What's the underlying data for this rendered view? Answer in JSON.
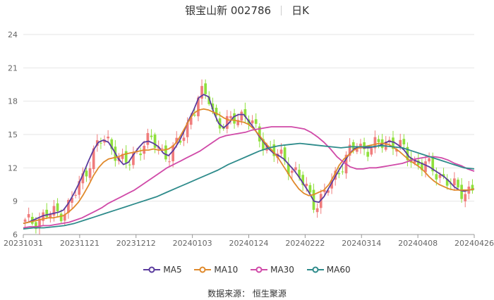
{
  "header": {
    "stock_title": "银宝山新 002786",
    "period": "日K"
  },
  "source": "数据来源：  恒生聚源",
  "legend": [
    {
      "name": "MA5",
      "color": "#5b3c9e"
    },
    {
      "name": "MA10",
      "color": "#e08a2c"
    },
    {
      "name": "MA30",
      "color": "#d04aa8"
    },
    {
      "name": "MA60",
      "color": "#2e8b8b"
    }
  ],
  "colors": {
    "up": "#f07c7c",
    "down": "#8fe03c",
    "grid": "#e6e6e6",
    "axis_text": "#666666"
  },
  "chart_data": {
    "type": "candlestick",
    "title": "银宝山新 002786 日K",
    "y_ticks": [
      6,
      9,
      12,
      15,
      18,
      21,
      24
    ],
    "ylim": [
      6,
      24
    ],
    "x_tick_labels": [
      "20231031",
      "20231121",
      "20231212",
      "20240103",
      "20240124",
      "20240222",
      "20240314",
      "20240408",
      "20240426"
    ],
    "grid": true,
    "legend_position": "bottom",
    "series": [
      {
        "name": "MA5",
        "values": [
          7.0,
          7.1,
          7.3,
          7.5,
          7.7,
          7.8,
          7.9,
          8.0,
          8.2,
          8.8,
          9.6,
          10.5,
          11.5,
          12.6,
          13.6,
          14.3,
          14.5,
          14.3,
          13.6,
          12.8,
          12.3,
          12.5,
          13.2,
          13.8,
          14.3,
          14.4,
          14.2,
          13.9,
          13.3,
          13.1,
          13.6,
          14.3,
          15.2,
          16.3,
          17.2,
          18.3,
          18.6,
          18.4,
          17.0,
          16.0,
          15.6,
          16.0,
          16.6,
          16.8,
          16.8,
          16.2,
          15.6,
          14.9,
          14.3,
          13.7,
          13.3,
          13.1,
          12.8,
          12.3,
          11.8,
          11.2,
          10.5,
          9.8,
          9.0,
          8.9,
          9.4,
          10.2,
          11.0,
          11.8,
          12.5,
          13.2,
          13.7,
          13.9,
          13.8,
          13.8,
          13.9,
          14.0,
          14.2,
          14.4,
          14.3,
          14.0,
          13.6,
          13.0,
          12.7,
          12.5,
          12.3,
          12.1,
          11.8,
          11.5,
          11.2,
          10.8,
          10.3,
          10.0,
          9.9,
          10.0,
          10.1
        ]
      },
      {
        "name": "MA10",
        "values": [
          7.0,
          7.1,
          7.2,
          7.3,
          7.4,
          7.5,
          7.5,
          7.6,
          7.7,
          8.0,
          8.4,
          8.9,
          9.6,
          10.4,
          11.3,
          12.0,
          12.5,
          12.8,
          12.9,
          13.0,
          13.2,
          13.3,
          13.4,
          13.5,
          13.6,
          13.6,
          13.7,
          13.6,
          13.6,
          13.7,
          14.0,
          14.6,
          15.4,
          16.2,
          16.9,
          17.2,
          17.3,
          17.2,
          17.0,
          16.8,
          16.5,
          16.3,
          16.3,
          16.2,
          16.1,
          15.9,
          15.5,
          15.0,
          14.4,
          13.9,
          13.4,
          12.8,
          12.1,
          11.4,
          10.7,
          10.1,
          9.7,
          9.5,
          9.6,
          9.8,
          10.0,
          10.5,
          11.3,
          12.2,
          12.8,
          13.2,
          13.6,
          13.8,
          13.9,
          14.0,
          14.1,
          14.2,
          14.2,
          14.1,
          13.8,
          13.5,
          13.1,
          12.7,
          12.4,
          12.1,
          11.7,
          11.2,
          10.8,
          10.5,
          10.3,
          10.1,
          10.0,
          10.0,
          10.0,
          10.0,
          10.1
        ]
      },
      {
        "name": "MA30",
        "values": [
          6.6,
          6.7,
          6.7,
          6.8,
          6.8,
          6.9,
          7.0,
          7.1,
          7.3,
          7.5,
          7.8,
          8.1,
          8.4,
          8.8,
          9.1,
          9.4,
          9.7,
          10.0,
          10.4,
          10.8,
          11.2,
          11.6,
          12.0,
          12.3,
          12.6,
          12.9,
          13.2,
          13.5,
          13.9,
          14.3,
          14.7,
          14.9,
          15.0,
          15.1,
          15.2,
          15.4,
          15.5,
          15.6,
          15.7,
          15.7,
          15.7,
          15.7,
          15.6,
          15.5,
          15.2,
          14.8,
          14.3,
          13.7,
          13.0,
          12.5,
          12.1,
          11.9,
          11.9,
          12.0,
          12.0,
          12.1,
          12.2,
          12.3,
          12.4,
          12.6,
          12.8,
          12.9,
          13.0,
          13.0,
          12.9,
          12.7,
          12.4,
          12.2,
          11.9,
          11.7
        ]
      },
      {
        "name": "MA60",
        "values": [
          6.5,
          6.6,
          6.6,
          6.7,
          6.8,
          7.0,
          7.3,
          7.6,
          7.9,
          8.2,
          8.5,
          8.8,
          9.1,
          9.4,
          9.8,
          10.2,
          10.6,
          11.0,
          11.4,
          11.8,
          12.3,
          12.7,
          13.1,
          13.5,
          13.8,
          14.0,
          14.1,
          14.2,
          14.1,
          14.0,
          13.9,
          13.8,
          13.9,
          13.9,
          13.9,
          14.0,
          13.9,
          13.8,
          13.5,
          13.2,
          12.9,
          12.6,
          12.3,
          12.0,
          11.9
        ]
      }
    ]
  }
}
